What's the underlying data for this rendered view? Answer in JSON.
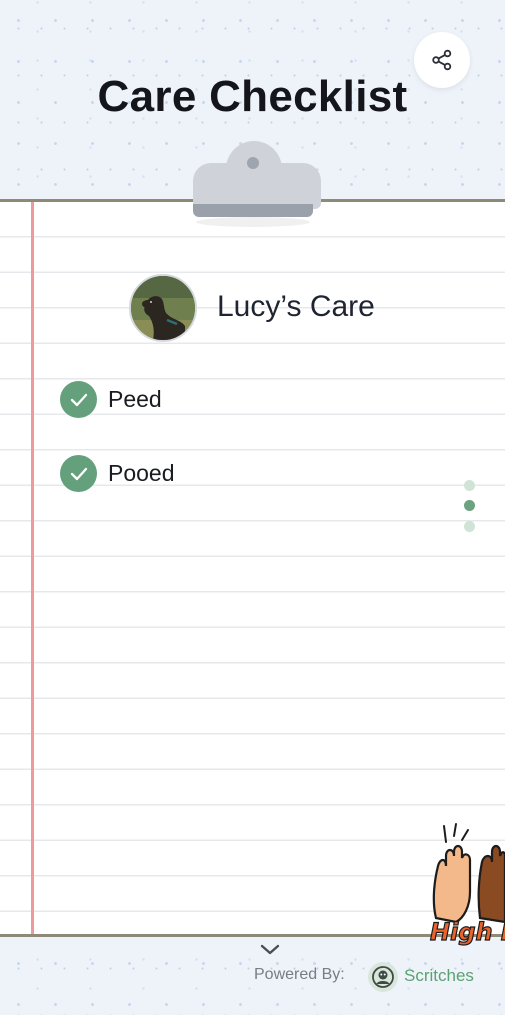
{
  "page": {
    "title": "Care Checklist",
    "pet_name": "Lucy’s Care"
  },
  "tasks": [
    {
      "label": "Peed",
      "done": true
    },
    {
      "label": "Pooed",
      "done": true
    }
  ],
  "pager": {
    "count": 3,
    "active_index": 1
  },
  "footer": {
    "powered_by": "Powered By:",
    "brand": "Scritches"
  },
  "sticker": {
    "text": "High Fi"
  },
  "colors": {
    "accent": "#65a07c",
    "brand": "#5aa271",
    "margin_line": "#ef9a9a",
    "title": "#14161b"
  },
  "icons": {
    "share": "share-icon",
    "check": "check-icon",
    "chevron": "chevron-down-icon",
    "brand_logo": "scritches-logo-icon"
  }
}
